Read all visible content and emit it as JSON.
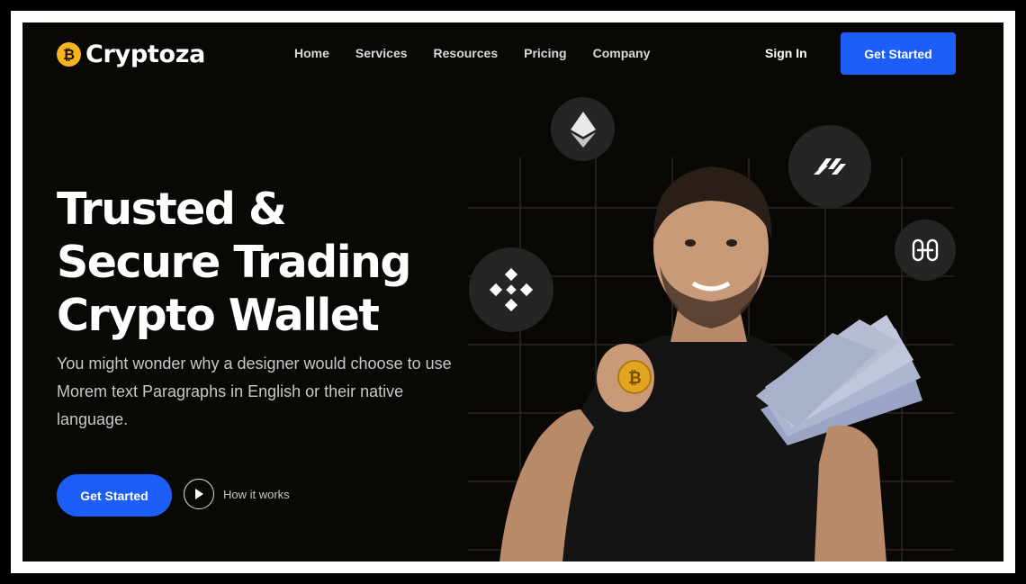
{
  "brand": {
    "name": "Cryptoza",
    "coin_symbol": "₿",
    "coin_color": "#f5b41d"
  },
  "nav": {
    "items": [
      "Home",
      "Services",
      "Resources",
      "Pricing",
      "Company"
    ],
    "sign_in": "Sign In",
    "cta": "Get Started"
  },
  "hero": {
    "title_lines": [
      "Trusted &",
      "Secure Trading",
      "Crypto Wallet"
    ],
    "description": "You might wonder why a designer would choose to use Morem text Paragraphs in English or their native language.",
    "cta": "Get Started",
    "how_it_works": "How it works"
  },
  "icons": [
    "ethereum-icon",
    "harmony-icon",
    "binance-icon",
    "hedera-icon",
    "play-icon"
  ],
  "colors": {
    "accent": "#1e5ef8",
    "background": "#0a0805",
    "icon_bg": "#252525"
  }
}
